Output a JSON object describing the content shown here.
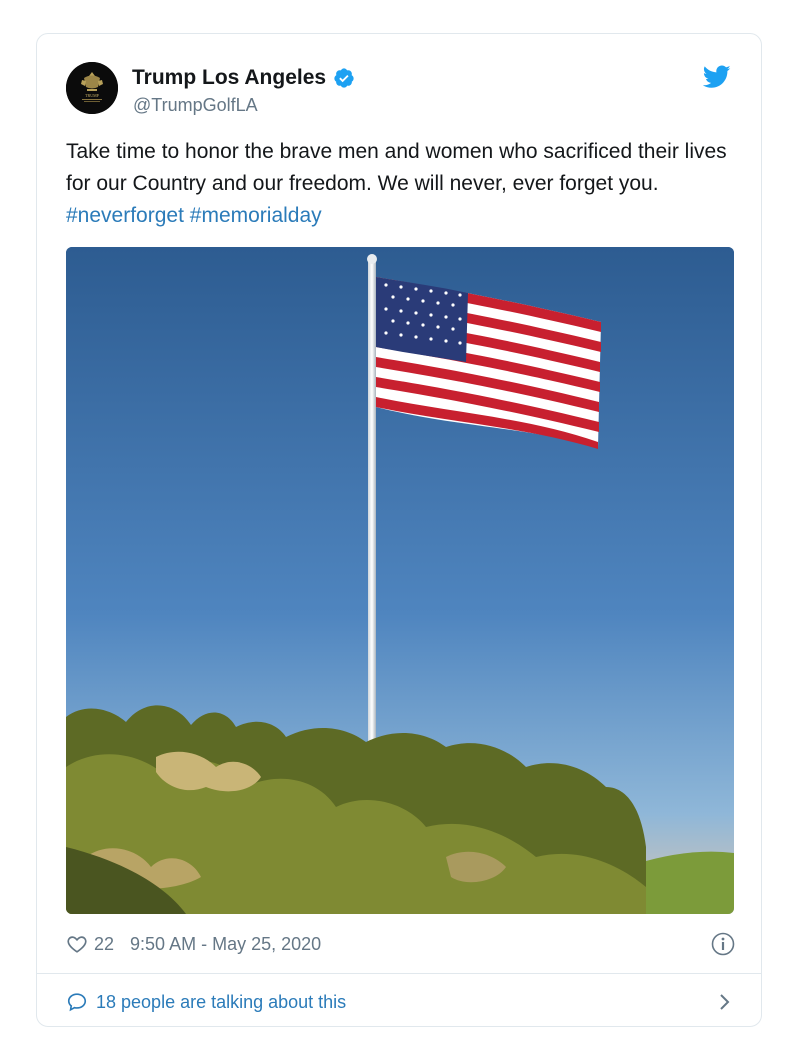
{
  "tweet": {
    "author_name": "Trump Los Angeles",
    "handle": "@TrumpGolfLA",
    "text_plain": "Take time to honor the brave men and women who sacrificed their lives for our Country and our freedom. We will never, ever forget you.",
    "hashtags": [
      "#neverforget",
      "#memorialday"
    ],
    "likes": "22",
    "timestamp": "9:50 AM - May 25, 2020",
    "conversation_text": "18 people are talking about this"
  },
  "icons": {
    "verified": "verified-badge-icon",
    "brand": "twitter-bird-icon",
    "like": "heart-icon",
    "info": "info-icon",
    "reply": "speech-bubble-icon",
    "more": "chevron-right-icon"
  },
  "colors": {
    "link": "#2b7bb9",
    "muted": "#657786",
    "verified": "#1da1f2",
    "border": "#e1e8ed"
  },
  "avatar": {
    "logo_text": "TRUMP"
  }
}
